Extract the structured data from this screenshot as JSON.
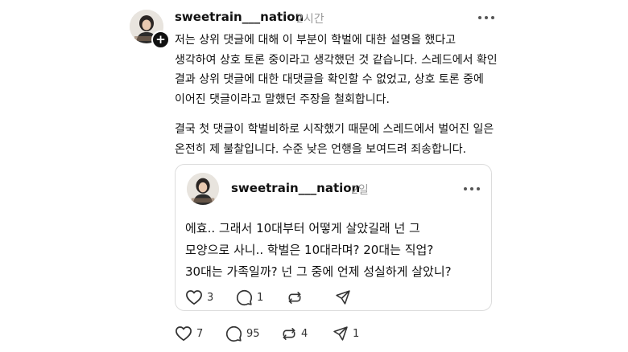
{
  "post": {
    "username": "sweetrain___nation",
    "time": "2시간",
    "avatar_badge": "+",
    "paragraphs": [
      [
        "저는 상위 댓글에 대해 이 부분이 학벌에 대한 설명을 했다고",
        "생각하여 상호 토론 중이라고 생각했던 것 같습니다. 스레드에서 확인",
        "결과 상위 댓글에 대한 대댓글을 확인할 수 없었고,  상호 토론 중에",
        "이어진 댓글이라고 말했던 주장을 철회합니다."
      ],
      [
        "결국 첫 댓글이 학벌비하로 시작했기 때문에 스레드에서 벌어진 일은",
        "온전히 제 불찰입니다. 수준 낮은 언행을 보여드려 죄송합니다."
      ]
    ],
    "actions": {
      "likes": "7",
      "comments": "95",
      "reposts": "4",
      "shares": "1"
    }
  },
  "quoted_post": {
    "username": "sweetrain___nation",
    "time": "2일",
    "lines": [
      "에효.. 그래서 10대부터 어떻게 살았길래 넌 그",
      "모양으로 사니.. 학벌은 10대라며? 20대는 직업?",
      "30대는 가족일까? 넌 그 중에 언제 성실하게 살았니?"
    ],
    "actions": {
      "likes": "3",
      "comments": "1",
      "reposts": "",
      "shares": ""
    }
  },
  "icons": {
    "like": "heart-icon",
    "comment": "comment-bubble-icon",
    "repost": "repost-icon",
    "share": "send-icon",
    "more": "more-horizontal-icon",
    "follow": "plus-icon"
  }
}
